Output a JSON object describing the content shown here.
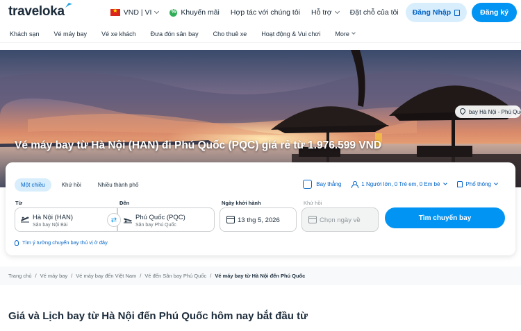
{
  "header": {
    "logo": "traveloka",
    "currency_lang": "VND | VI",
    "promo": "Khuyến mãi",
    "partner": "Hợp tác với chúng tôi",
    "support": "Hỗ trợ",
    "my_bookings": "Đặt chỗ của tôi",
    "login": "Đăng Nhập",
    "register": "Đăng ký"
  },
  "nav": {
    "items": [
      {
        "label": "Khách sạn"
      },
      {
        "label": "Vé máy bay"
      },
      {
        "label": "Vé xe khách"
      },
      {
        "label": "Đưa đón sân bay"
      },
      {
        "label": "Cho thuê xe"
      },
      {
        "label": "Hoạt động & Vui chơi"
      },
      {
        "label": "More"
      }
    ]
  },
  "hero": {
    "title": "Vé máy bay từ Hà Nội (HAN) đi Phú Quốc (PQC) giá rẻ từ 1.976.599 VND",
    "location_chip": "bay Hà Nội - Phú Quốc"
  },
  "search": {
    "trip_types": [
      {
        "label": "Một chiều",
        "active": true
      },
      {
        "label": "Khứ hồi",
        "active": false
      },
      {
        "label": "Nhiều thành phố",
        "active": false
      }
    ],
    "direct_flight": "Bay thẳng",
    "passengers": "1 Người lớn, 0 Trẻ em, 0 Em bé",
    "seat_class": "Phổ thông",
    "from_label": "Từ",
    "from_city": "Hà Nội (HAN)",
    "from_airport": "Sân bay Nội Bài",
    "to_label": "Đến",
    "to_city": "Phú Quốc (PQC)",
    "to_airport": "Sân bay Phú Quốc",
    "depart_label": "Ngày khởi hành",
    "depart_date": "13 thg 5, 2026",
    "return_label": "Khứ hồi",
    "return_placeholder": "Chọn ngày về",
    "search_button": "Tìm chuyến bay",
    "idea_link": "Tìm ý tưởng chuyến bay thú vị ở đây"
  },
  "breadcrumb": {
    "items": [
      "Trang chủ",
      "Vé máy bay",
      "Vé máy bay đến Việt Nam",
      "Vé đến Sân bay Phú Quốc"
    ],
    "current": "Vé máy bay từ Hà Nội đến Phú Quốc"
  },
  "section": {
    "title": "Giá và Lịch bay từ Hà Nội đến Phú Quốc hôm nay bắt đầu từ"
  },
  "colors": {
    "brand_blue": "#0194f3",
    "brand_dark_blue": "#0264c8",
    "light_blue": "#d8eefc",
    "text_dark": "#1b2b3a"
  }
}
